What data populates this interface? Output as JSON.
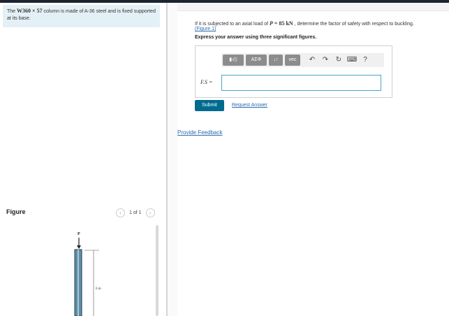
{
  "problem": {
    "text_before": "The ",
    "section": "W360 × 57",
    "text_after": " column is made of A-36 steel and is fixed supported at its base."
  },
  "question": {
    "text_before": "If it is subjected to an axial load of ",
    "load_var": "P",
    "load_value": " = 85 kN",
    "text_after": " , determine the factor of safety with respect to buckling.",
    "figure_link": "(Figure 1)",
    "instruction": "Express your answer using three significant figures."
  },
  "toolbar": {
    "template_btn": "▮√▯",
    "greek_btn": "ΑΣΦ",
    "arrows_btn": "↓↑",
    "vec_btn": "vec",
    "undo": "↶",
    "redo": "↷",
    "reset": "↻",
    "keyboard": "⌨",
    "help": "?"
  },
  "answer": {
    "label": "F.S =",
    "value": ""
  },
  "actions": {
    "submit": "Submit",
    "request_answer": "Request Answer",
    "provide_feedback": "Provide Feedback"
  },
  "figure": {
    "title": "Figure",
    "pager": "1 of 1",
    "prev": "‹",
    "next": "›",
    "load_label": "P",
    "length_label": "6 m"
  }
}
